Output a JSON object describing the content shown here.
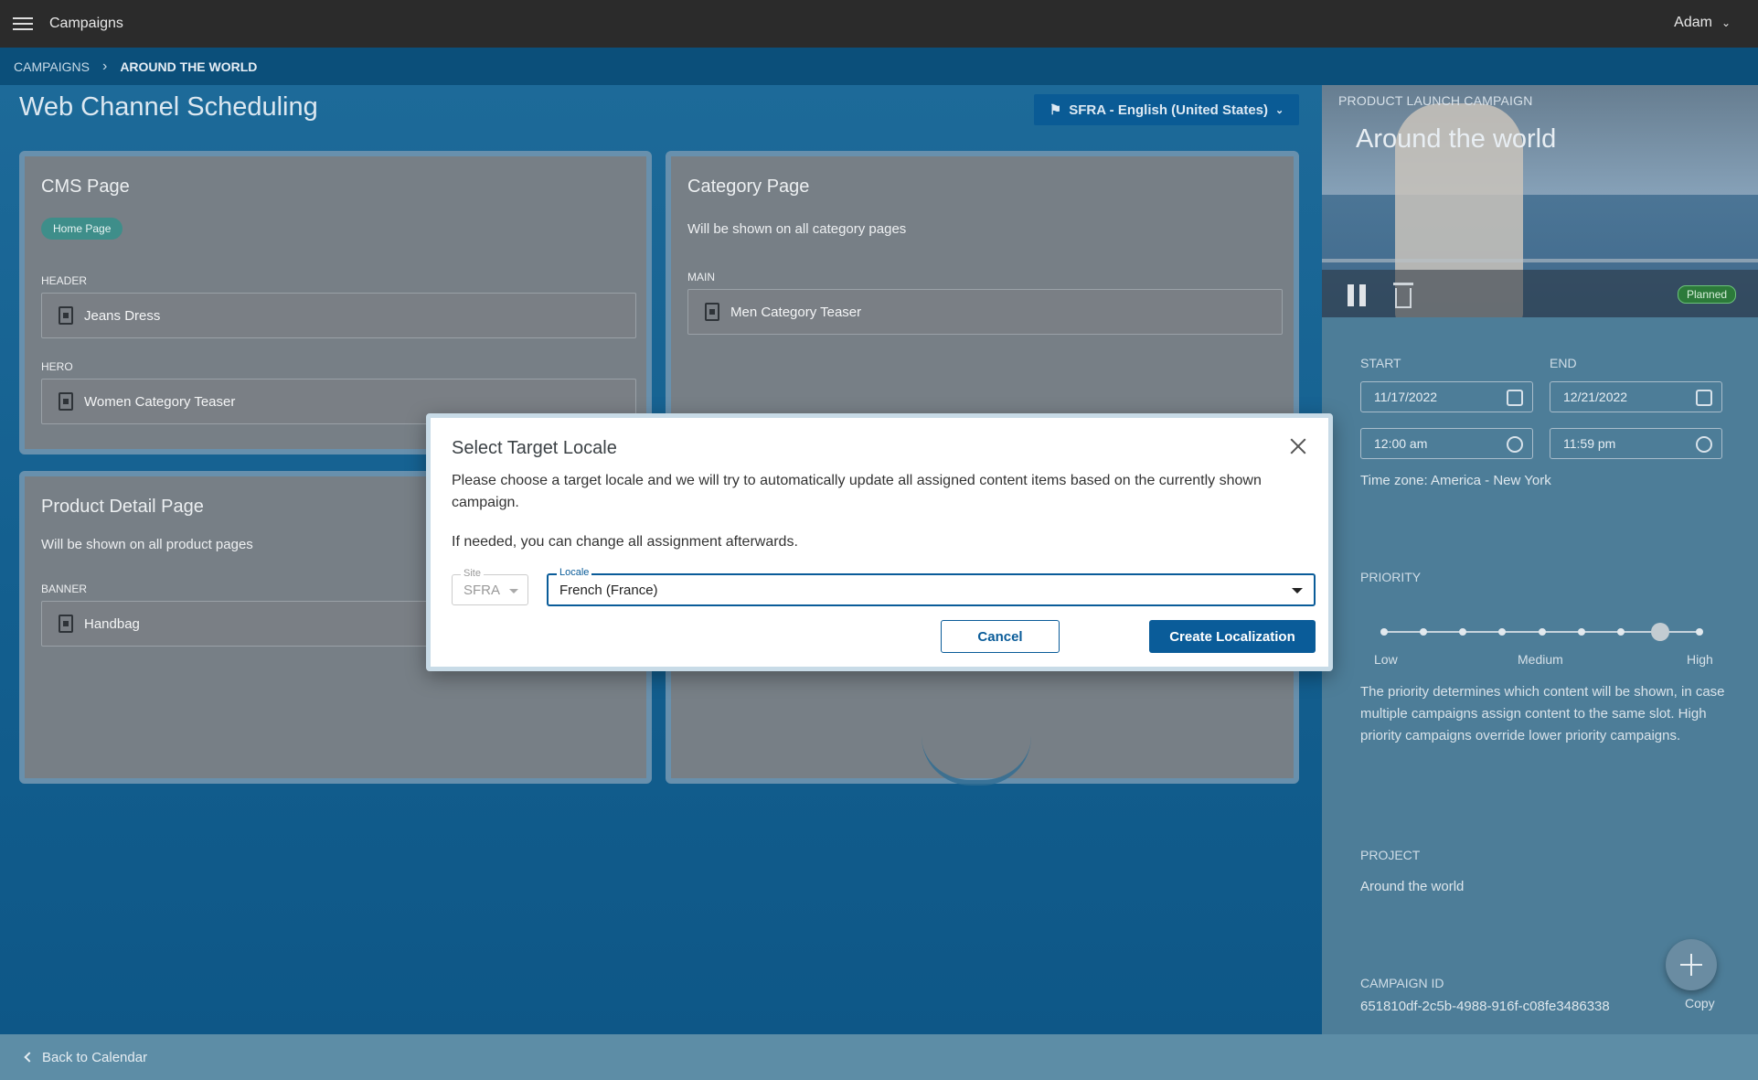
{
  "topbar": {
    "app_title": "Campaigns",
    "user_name": "Adam"
  },
  "breadcrumb": {
    "root": "CAMPAIGNS",
    "separator": "›",
    "current": "AROUND THE WORLD"
  },
  "main": {
    "page_title": "Web Channel Scheduling",
    "site_locale_button": "SFRA - English (United States)",
    "cards": {
      "cms": {
        "title": "CMS Page",
        "chip": "Home Page",
        "slots": [
          {
            "label": "HEADER",
            "item": "Jeans Dress"
          },
          {
            "label": "HERO",
            "item": "Women Category Teaser"
          }
        ]
      },
      "category": {
        "title": "Category Page",
        "desc": "Will be shown on all category pages",
        "slots": [
          {
            "label": "MAIN",
            "item": "Men Category Teaser"
          }
        ]
      },
      "pdp": {
        "title": "Product Detail Page",
        "desc": "Will be shown on all product pages",
        "slots": [
          {
            "label": "BANNER",
            "item": "Handbag"
          }
        ]
      }
    }
  },
  "campaign": {
    "kicker": "PRODUCT LAUNCH CAMPAIGN",
    "title": "Around the world",
    "status": "Planned",
    "start_label": "START",
    "end_label": "END",
    "start_date": "11/17/2022",
    "end_date": "12/21/2022",
    "start_time": "12:00 am",
    "end_time": "11:59 pm",
    "timezone": "Time zone: America - New York",
    "priority_label": "PRIORITY",
    "priority_low": "Low",
    "priority_medium": "Medium",
    "priority_high": "High",
    "priority_value": 7,
    "priority_max": 8,
    "priority_desc": "The priority determines which content will be shown, in case multiple campaigns assign content to the same slot. High priority campaigns override lower priority campaigns.",
    "project_label": "PROJECT",
    "project_value": "Around the world",
    "id_label": "CAMPAIGN ID",
    "id_value": "651810df-2c5b-4988-916f-c08fe3486338",
    "copy_label": "Copy"
  },
  "footer": {
    "back_label": "Back to Calendar"
  },
  "modal": {
    "title": "Select Target Locale",
    "text1": "Please choose a target locale and we will try to automatically update all assigned content items based on the currently shown campaign.",
    "text2": "If needed, you can change all assignment afterwards.",
    "site_label": "Site",
    "site_value": "SFRA",
    "locale_label": "Locale",
    "locale_value": "French (France)",
    "cancel_label": "Cancel",
    "create_label": "Create Localization"
  }
}
